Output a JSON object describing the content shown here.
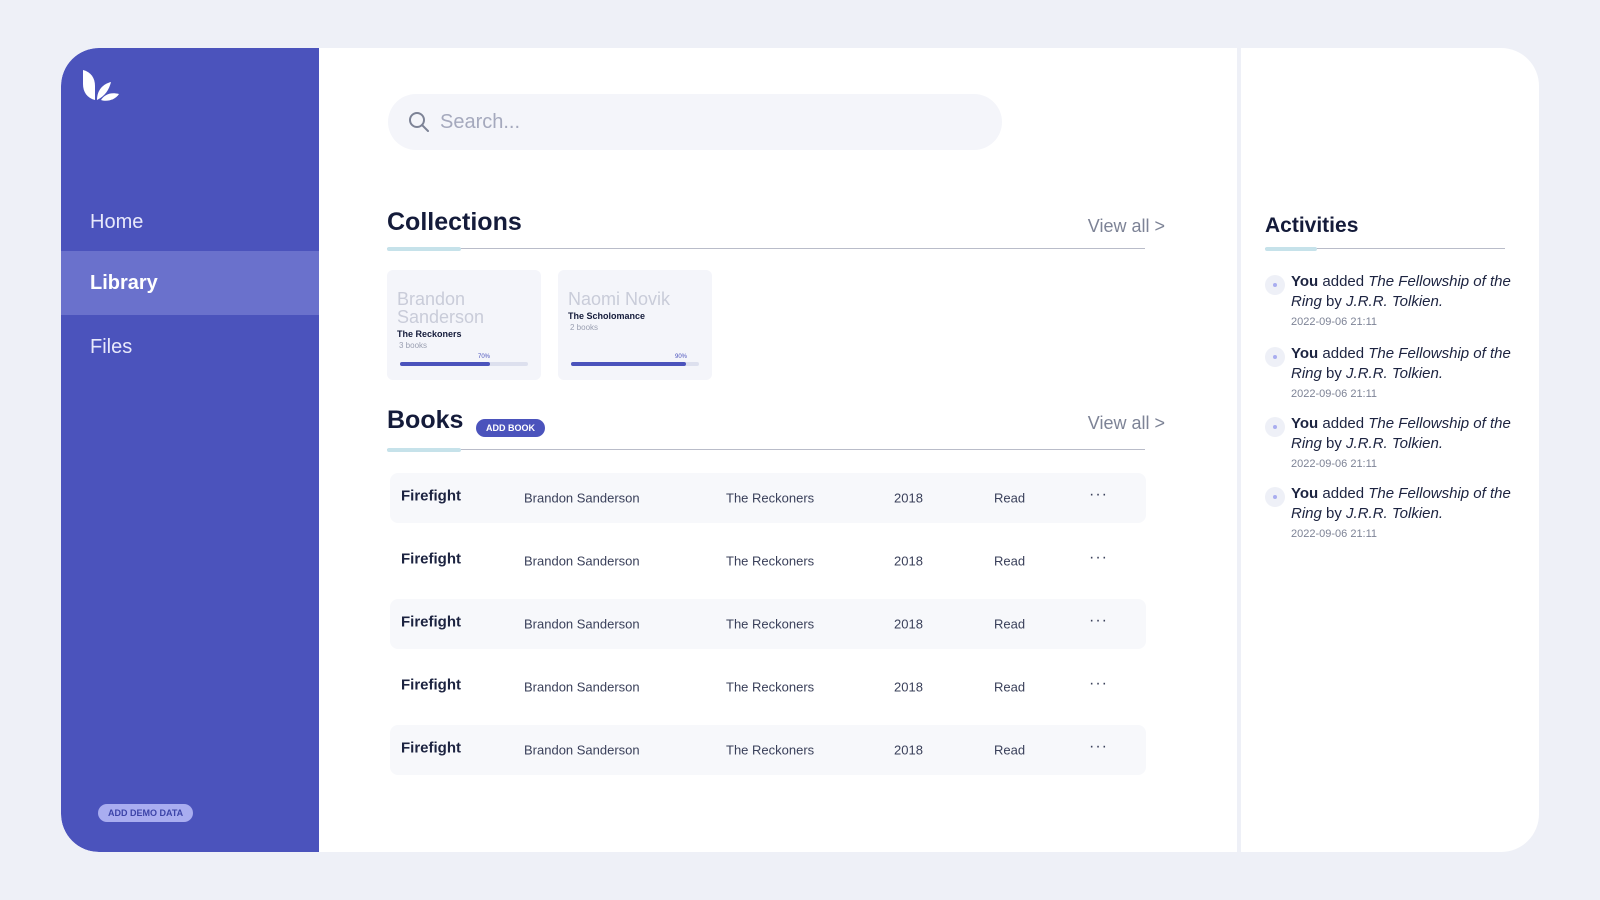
{
  "sidebar": {
    "nav": [
      {
        "label": "Home",
        "active": false
      },
      {
        "label": "Library",
        "active": true
      },
      {
        "label": "Files",
        "active": false
      }
    ],
    "demo_label": "ADD DEMO DATA"
  },
  "search": {
    "placeholder": "Search..."
  },
  "collections": {
    "title": "Collections",
    "view_all": "View all  >",
    "cards": [
      {
        "author": "Brandon Sanderson",
        "name": "The Reckoners",
        "count": "3 books",
        "progress_label": "70%",
        "progress": 0.7
      },
      {
        "author": "Naomi Novik",
        "name": "The Scholomance",
        "count": "2 books",
        "progress_label": "90%",
        "progress": 0.9
      }
    ]
  },
  "books": {
    "title": "Books",
    "add_label": "ADD BOOK",
    "view_all": "View all  >",
    "rows": [
      {
        "title": "Firefight",
        "author": "Brandon Sanderson",
        "collection": "The Reckoners",
        "year": "2018",
        "status": "Read",
        "more": "···"
      },
      {
        "title": "Firefight",
        "author": "Brandon Sanderson",
        "collection": "The Reckoners",
        "year": "2018",
        "status": "Read",
        "more": "···"
      },
      {
        "title": "Firefight",
        "author": "Brandon Sanderson",
        "collection": "The Reckoners",
        "year": "2018",
        "status": "Read",
        "more": "···"
      },
      {
        "title": "Firefight",
        "author": "Brandon Sanderson",
        "collection": "The Reckoners",
        "year": "2018",
        "status": "Read",
        "more": "···"
      },
      {
        "title": "Firefight",
        "author": "Brandon Sanderson",
        "collection": "The Reckoners",
        "year": "2018",
        "status": "Read",
        "more": "···"
      }
    ]
  },
  "activities": {
    "title": "Activities",
    "items": [
      {
        "actor": "You",
        "verb": " added ",
        "book": "The Fellowship of the Ring",
        "by": " by ",
        "author": "J.R.R. Tolkien.",
        "time": "2022-09-06 21:11"
      },
      {
        "actor": "You",
        "verb": " added ",
        "book": "The Fellowship of the Ring",
        "by": " by ",
        "author": "J.R.R. Tolkien.",
        "time": "2022-09-06 21:11"
      },
      {
        "actor": "You",
        "verb": " added ",
        "book": "The Fellowship of the Ring",
        "by": " by ",
        "author": "J.R.R. Tolkien.",
        "time": "2022-09-06 21:11"
      },
      {
        "actor": "You",
        "verb": " added ",
        "book": "The Fellowship of the Ring",
        "by": " by ",
        "author": "J.R.R. Tolkien.",
        "time": "2022-09-06 21:11"
      }
    ]
  },
  "colors": {
    "sidebar": "#4b53bc",
    "accent": "#4b53bc",
    "page_bg": "#eef0f7",
    "underline_accent": "#c6e2ea"
  }
}
